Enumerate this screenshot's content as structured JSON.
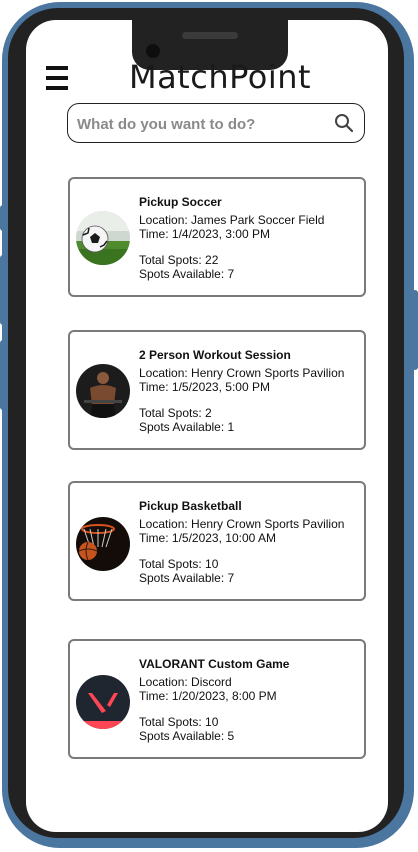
{
  "app": {
    "title": "MatchPoint"
  },
  "search": {
    "placeholder": "What do you want to do?",
    "icon": "search-icon"
  },
  "events": [
    {
      "name": "Pickup Soccer",
      "location": "Location: James Park Soccer Field",
      "time": "Time: 1/4/2023, 3:00 PM",
      "total_spots": "Total Spots: 22",
      "spots_available": "Spots Available: 7",
      "image": "soccer-ball-image"
    },
    {
      "name": "2 Person Workout Session",
      "location": "Location:  Henry Crown Sports Pavilion",
      "time": "Time: 1/5/2023, 5:00 PM",
      "total_spots": "Total Spots: 2",
      "spots_available": "Spots Available: 1",
      "image": "workout-athlete-image"
    },
    {
      "name": "Pickup Basketball",
      "location": "Location: Henry Crown Sports Pavilion",
      "time": "Time: 1/5/2023, 10:00 AM",
      "total_spots": "Total Spots: 10",
      "spots_available": "Spots Available: 7",
      "image": "basketball-hoop-image"
    },
    {
      "name": "VALORANT Custom Game",
      "location": "Location: Discord",
      "time": "Time: 1/20/2023, 8:00 PM",
      "total_spots": "Total Spots: 10",
      "spots_available": "Spots Available: 5",
      "image": "valorant-logo-image"
    }
  ],
  "colors": {
    "frame": "#4a76a0",
    "bezel": "#222222",
    "card_border": "#7a7a7a",
    "valorant_red": "#ff4655"
  }
}
